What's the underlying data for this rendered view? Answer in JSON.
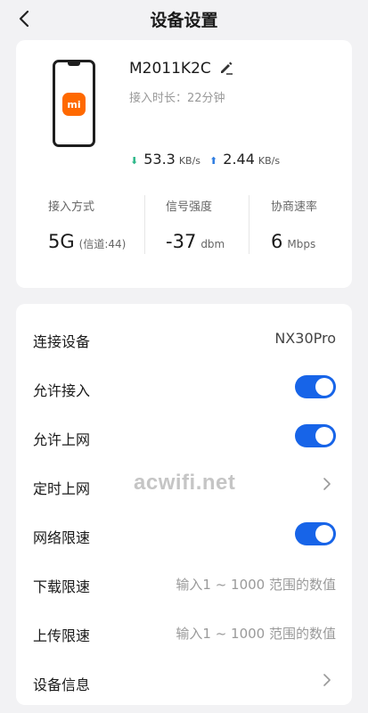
{
  "header": {
    "title": "设备设置"
  },
  "device": {
    "name": "M2011K2C",
    "logo_text": "mi",
    "online_time": "接入时长：22分钟",
    "download_speed": "53.3",
    "download_unit": "KB/s",
    "upload_speed": "2.44",
    "upload_unit": "KB/s"
  },
  "stats": [
    {
      "label": "接入方式",
      "value": "5G",
      "sub": "(信道:44)"
    },
    {
      "label": "信号强度",
      "value": "-37",
      "sub": "dbm"
    },
    {
      "label": "协商速率",
      "value": "6",
      "sub": "Mbps"
    }
  ],
  "settings": {
    "connected_device": {
      "label": "连接设备",
      "value": "NX30Pro"
    },
    "allow_access": {
      "label": "允许接入",
      "enabled": true
    },
    "allow_internet": {
      "label": "允许上网",
      "enabled": true
    },
    "scheduled_internet": {
      "label": "定时上网"
    },
    "speed_limit": {
      "label": "网络限速",
      "enabled": true
    },
    "download_limit": {
      "label": "下载限速",
      "placeholder": "输入1 ~ 1000 范围的数值"
    },
    "upload_limit": {
      "label": "上传限速",
      "placeholder": "输入1 ~ 1000 范围的数值"
    },
    "device_info": {
      "label": "设备信息"
    }
  },
  "watermark": "acwifi.net",
  "colors": {
    "accent": "#1764e8",
    "download_arrow": "#2fb88a",
    "upload_arrow": "#2f7de1",
    "brand_orange": "#ff6900"
  },
  "icons": {
    "back": "back-arrow-icon",
    "edit": "edit-pencil-icon",
    "chevron": "chevron-right-icon"
  }
}
